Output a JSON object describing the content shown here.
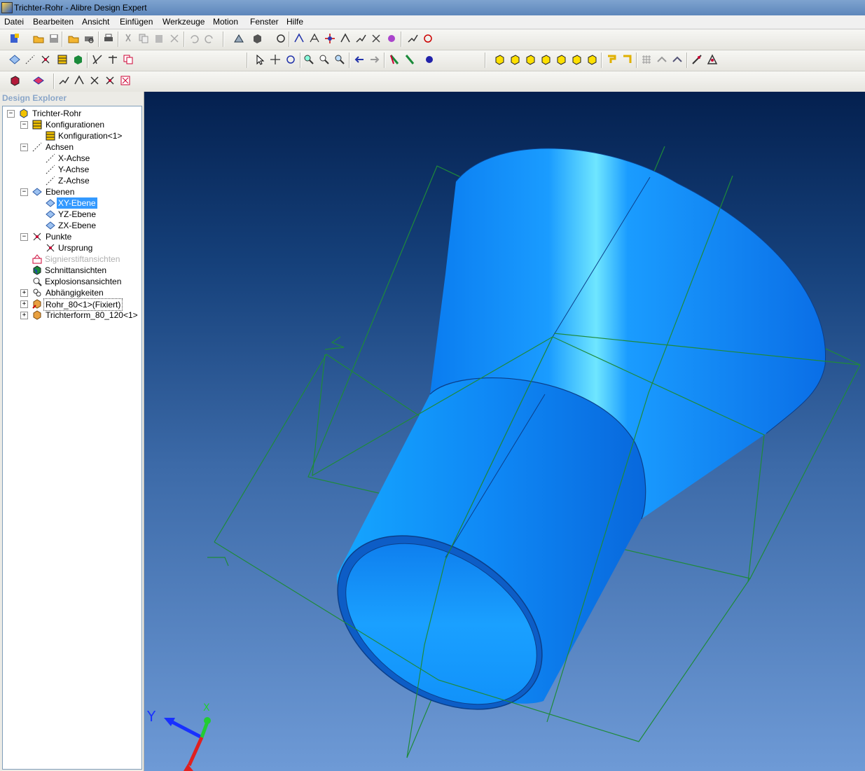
{
  "window": {
    "title": "Trichter-Rohr - Alibre Design Expert"
  },
  "menu": [
    {
      "label": "Datei",
      "accel": "D"
    },
    {
      "label": "Bearbeiten",
      "accel": "B"
    },
    {
      "label": "Ansicht",
      "accel": "A"
    },
    {
      "label": "Einfügen",
      "accel": "E"
    },
    {
      "label": "Werkzeuge",
      "accel": "W"
    },
    {
      "label": "Motion",
      "accel": "M"
    },
    {
      "label": "Fenster",
      "accel": "F"
    },
    {
      "label": "Hilfe",
      "accel": "H"
    }
  ],
  "explorer": {
    "title": "Design Explorer",
    "root": "Trichter-Rohr",
    "configurations": {
      "label": "Konfigurationen",
      "item": "Konfiguration<1>"
    },
    "axes": {
      "label": "Achsen",
      "items": [
        "X-Achse",
        "Y-Achse",
        "Z-Achse"
      ]
    },
    "planes": {
      "label": "Ebenen",
      "items": [
        "XY-Ebene",
        "YZ-Ebene",
        "ZX-Ebene"
      ],
      "selected": "XY-Ebene"
    },
    "points": {
      "label": "Punkte",
      "item": "Ursprung"
    },
    "markup_views": "Signierstiftansichten",
    "section_views": "Schnittansichten",
    "exploded_views": "Explosionsansichten",
    "constraints": "Abhängigkeiten",
    "part1": "Rohr_80<1>(Fixiert)",
    "part2": "Trichterform_80_120<1>"
  },
  "viewport": {
    "triad_y_label": "Y",
    "triad_x_label": "X",
    "model_color": "#1a8cff",
    "plane_color": "#1f8a3a",
    "background_top": "#04204f",
    "background_bottom": "#6e9ad6"
  },
  "icons": {
    "toolbar1": [
      "new-icon",
      "open-icon",
      "save-icon",
      "open-folder-icon",
      "print-preview-icon",
      "print-icon",
      "cut-icon",
      "copy-icon",
      "paste-icon",
      "delete-icon",
      "undo-icon",
      "redo-icon",
      "assembly-icon",
      "view-cube-icon",
      "constraint-icon",
      "mate-icon",
      "align-icon",
      "orient-icon",
      "angle-icon",
      "motion-icon",
      "explode-icon",
      "animate-icon",
      "analyze-icon",
      "reset-icon"
    ],
    "toolbar2": [
      "plane-icon",
      "axis-icon",
      "point-icon",
      "table-icon",
      "part-icon",
      "sketch-icon",
      "balance-icon",
      "copy-part-icon",
      "select-arrow-icon",
      "pan-icon",
      "rotate-icon",
      "zoom-icon",
      "zoom-window-icon",
      "zoom-fit-icon",
      "back-icon",
      "forward-icon",
      "section-icon",
      "measure-icon",
      "render-icon",
      "iso-view-icon",
      "front-view-icon",
      "back-view-icon",
      "left-view-icon",
      "right-view-icon",
      "top-view-icon",
      "bottom-view-icon",
      "normal-view-icon",
      "rotate-left-icon",
      "grid-icon",
      "hide-icon",
      "show-icon",
      "visibility-icon",
      "tools-icon"
    ],
    "toolbar3": [
      "display-mode-icon",
      "shading-icon",
      "sketch-tool-icon",
      "dimension-icon",
      "check-icon",
      "clear-icon",
      "delete-feature-icon"
    ]
  }
}
